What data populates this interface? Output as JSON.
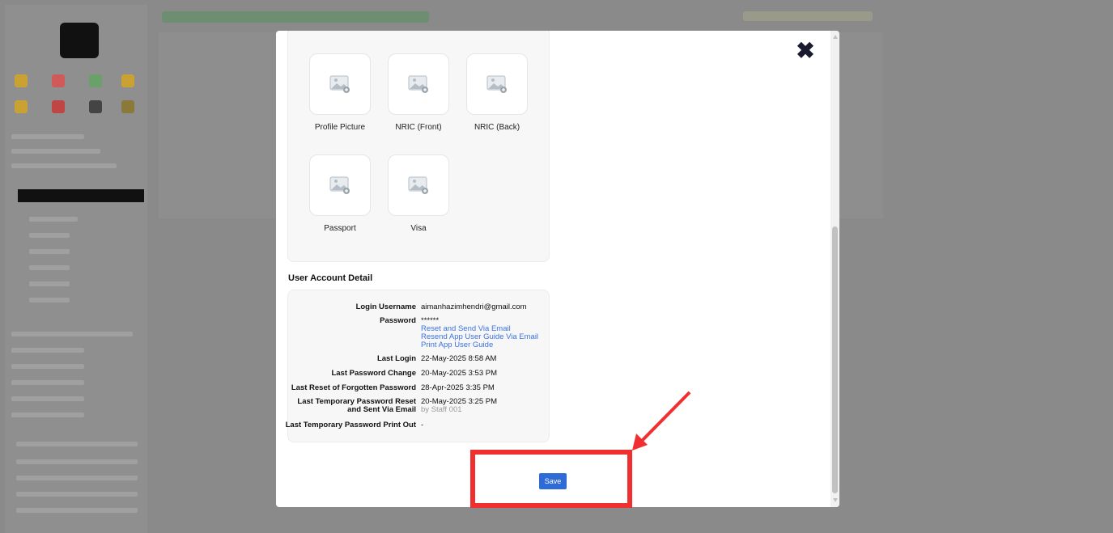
{
  "modal": {
    "close_icon": "close-icon",
    "documents": [
      {
        "label": "Profile Picture",
        "icon": "image-add-icon"
      },
      {
        "label": "NRIC (Front)",
        "icon": "image-add-icon"
      },
      {
        "label": "NRIC (Back)",
        "icon": "image-add-icon"
      },
      {
        "label": "Passport",
        "icon": "image-add-icon"
      },
      {
        "label": "Visa",
        "icon": "image-add-icon"
      }
    ],
    "account_section_title": "User Account Detail",
    "account": {
      "login_username_label": "Login Username",
      "login_username_value": "aimanhazimhendri@gmail.com",
      "password_label": "Password",
      "password_value": "******",
      "password_link_reset": "Reset and Send Via Email",
      "password_link_resend": "Resend App User Guide Via Email",
      "password_link_print": "Print App User Guide",
      "last_login_label": "Last Login",
      "last_login_value": "22-May-2025 8:58 AM",
      "last_password_change_label": "Last Password Change",
      "last_password_change_value": "20-May-2025 3:53 PM",
      "last_reset_forgotten_label": "Last Reset of Forgotten Password",
      "last_reset_forgotten_value": "28-Apr-2025 3:35 PM",
      "last_temp_reset_label_line1": "Last Temporary Password Reset",
      "last_temp_reset_label_line2": "and Sent Via Email",
      "last_temp_reset_value": "20-May-2025 3:25 PM",
      "last_temp_reset_by": "by Staff 001",
      "last_temp_print_label": "Last Temporary Password Print Out",
      "last_temp_print_value": "-"
    },
    "save_label": "Save"
  },
  "colors": {
    "accent": "#2f6bd6",
    "link": "#3b73e0",
    "annotation": "#f03030"
  }
}
